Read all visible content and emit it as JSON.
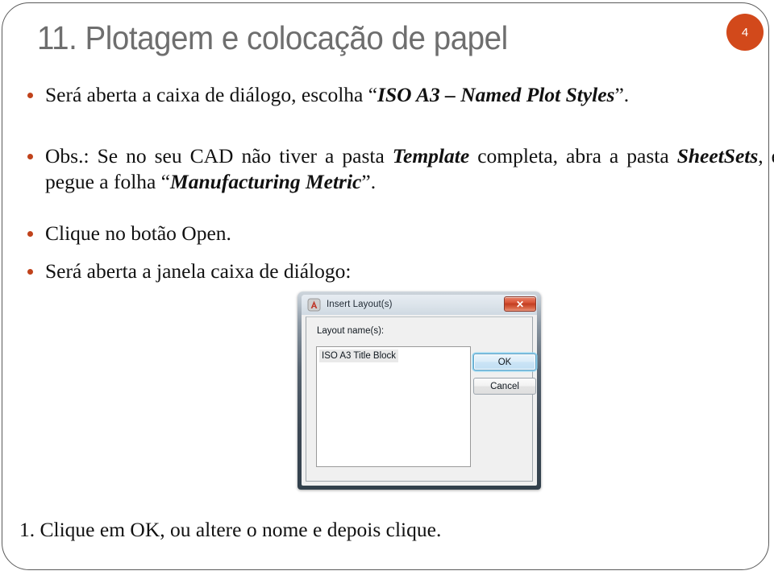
{
  "slide": {
    "number_badge": "4",
    "badge_color": "#d2491b",
    "title": "11. Plotagem e colocação de papel",
    "title_color": "#6e6e6e",
    "bullet_color": "#c0421b",
    "bullets": [
      {
        "id": "bullet-0",
        "segments": [
          {
            "text": "Será aberta a caixa de diálogo, escolha “",
            "style": "normal"
          },
          {
            "text": "ISO A3 – Named Plot Styles",
            "style": "bold-italic"
          },
          {
            "text": "”.",
            "style": "normal"
          }
        ],
        "plain": "Será aberta a caixa de diálogo, escolha “ISO A3 – Named Plot Styles”."
      },
      {
        "id": "bullet-1",
        "segments": [
          {
            "text": "Obs.: Se no seu CAD não tiver a pasta ",
            "style": "normal"
          },
          {
            "text": "Template",
            "style": "bold-italic"
          },
          {
            "text": " completa, abra a pasta ",
            "style": "normal"
          },
          {
            "text": "SheetSets",
            "style": "bold-italic"
          },
          {
            "text": ", e pegue a folha “",
            "style": "normal"
          },
          {
            "text": "Manufacturing Metric",
            "style": "bold-italic"
          },
          {
            "text": "”.",
            "style": "normal"
          }
        ],
        "plain": "Obs.: Se no seu CAD não tiver a pasta Template completa, abra a pasta SheetSets, e pegue a folha “Manufacturing Metric”."
      },
      {
        "id": "bullet-2",
        "segments": [
          {
            "text": "Clique no botão Open.",
            "style": "normal"
          }
        ],
        "plain": "Clique no botão Open."
      },
      {
        "id": "bullet-3",
        "segments": [
          {
            "text": "Será aberta a janela caixa de diálogo:",
            "style": "normal"
          }
        ],
        "plain": "Será aberta a janela caixa de diálogo:"
      }
    ],
    "footer_line": "1. Clique em OK, ou altere o nome e depois clique."
  },
  "dialog": {
    "icon_name": "autocad-a-icon",
    "title": "Insert Layout(s)",
    "close_label": "✕",
    "label": "Layout name(s):",
    "listbox": {
      "items": [
        "ISO A3 Title Block"
      ],
      "selected": "ISO A3 Title Block"
    },
    "buttons": {
      "ok": "OK",
      "cancel": "Cancel"
    }
  }
}
